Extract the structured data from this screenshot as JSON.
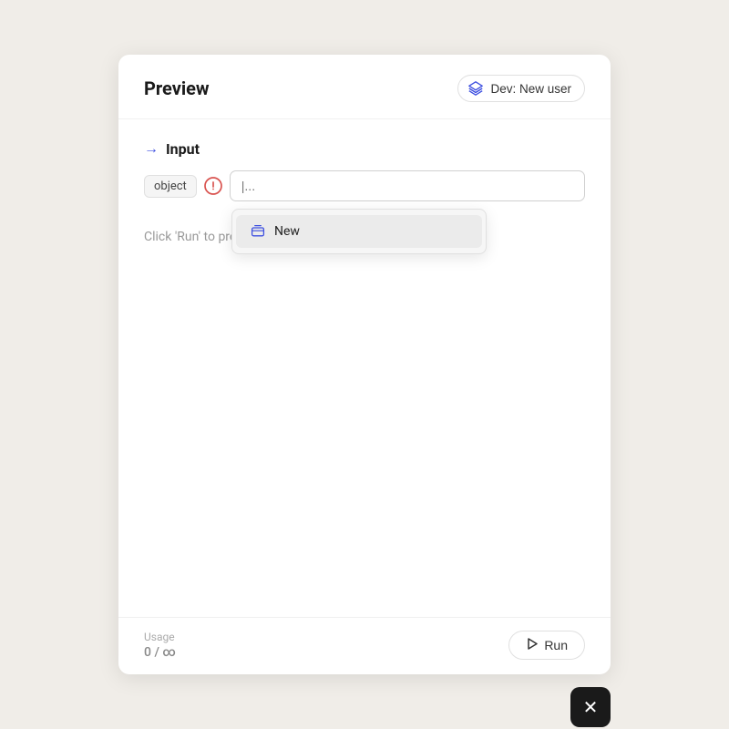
{
  "header": {
    "title": "Preview",
    "dev_badge_label": "Dev: New user"
  },
  "input_section": {
    "label": "Input",
    "arrow": "→",
    "object_badge": "object",
    "input_placeholder": "|...",
    "input_value": ""
  },
  "dropdown": {
    "items": [
      {
        "label": "New",
        "icon": "layers-icon"
      }
    ]
  },
  "hint": {
    "text": "Click 'Run' to preview and see logs, output or errors."
  },
  "footer": {
    "usage_label": "Usage",
    "usage_value": "0",
    "usage_separator": "/",
    "usage_max": "∞",
    "run_button_label": "Run"
  },
  "close_button": {
    "label": "✕"
  },
  "colors": {
    "accent": "#3d4fe0",
    "warning": "#d9534f",
    "background": "#f0ede8"
  }
}
